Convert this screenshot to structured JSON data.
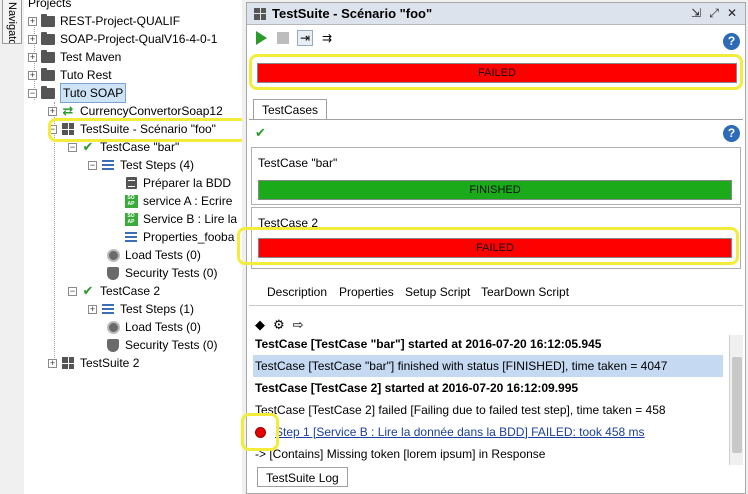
{
  "left_tab": {
    "label": "Navigator"
  },
  "tree": {
    "header": "Projects",
    "items": [
      {
        "label": "REST-Project-QUALIF"
      },
      {
        "label": "SOAP-Project-QualV16-4-0-1"
      },
      {
        "label": "Test Maven"
      },
      {
        "label": "Tuto Rest"
      },
      {
        "label": "Tuto SOAP"
      },
      {
        "label": "CurrencyConvertorSoap12"
      },
      {
        "label": "TestSuite - Scénario \"foo\""
      },
      {
        "label": "TestCase \"bar\""
      },
      {
        "label": "Test Steps (4)"
      },
      {
        "label": "Préparer la BDD"
      },
      {
        "label": "service A : Ecrire"
      },
      {
        "label": "Service B : Lire la"
      },
      {
        "label": "Properties_fooba"
      },
      {
        "label": "Load Tests (0)"
      },
      {
        "label": "Security Tests (0)"
      },
      {
        "label": "TestCase 2"
      },
      {
        "label": "Test Steps (1)"
      },
      {
        "label": "Load Tests (0)"
      },
      {
        "label": "Security Tests (0)"
      },
      {
        "label": "TestSuite 2"
      }
    ]
  },
  "panel": {
    "title": "TestSuite - Scénario \"foo\"",
    "suite_status": "FAILED",
    "tab_testcases": "TestCases",
    "help": "?",
    "testcases": [
      {
        "name": "TestCase \"bar\"",
        "status": "FINISHED"
      },
      {
        "name": "TestCase 2",
        "status": "FAILED"
      }
    ],
    "bottom_tabs": [
      "Description",
      "Properties",
      "Setup Script",
      "TearDown Script"
    ],
    "log": [
      "TestCase [TestCase \"bar\"] started at 2016-07-20 16:12:05.945",
      "TestCase [TestCase \"bar\"] finished with status [FINISHED], time taken = 4047",
      "TestCase [TestCase 2] started at 2016-07-20 16:12:09.995",
      "TestCase [TestCase 2] failed [Failing due to failed test step], time taken = 458",
      "Step 1 [Service B : Lire la donnée dans la BDD] FAILED: took 458 ms",
      "-> [Contains] Missing token [lorem ipsum] in Response"
    ],
    "log_tab": "TestSuite Log"
  },
  "colors": {
    "failed": "#ff0000",
    "finished": "#1aaa1a",
    "highlight": "#f4ec3a",
    "selection": "#c5daf2"
  }
}
